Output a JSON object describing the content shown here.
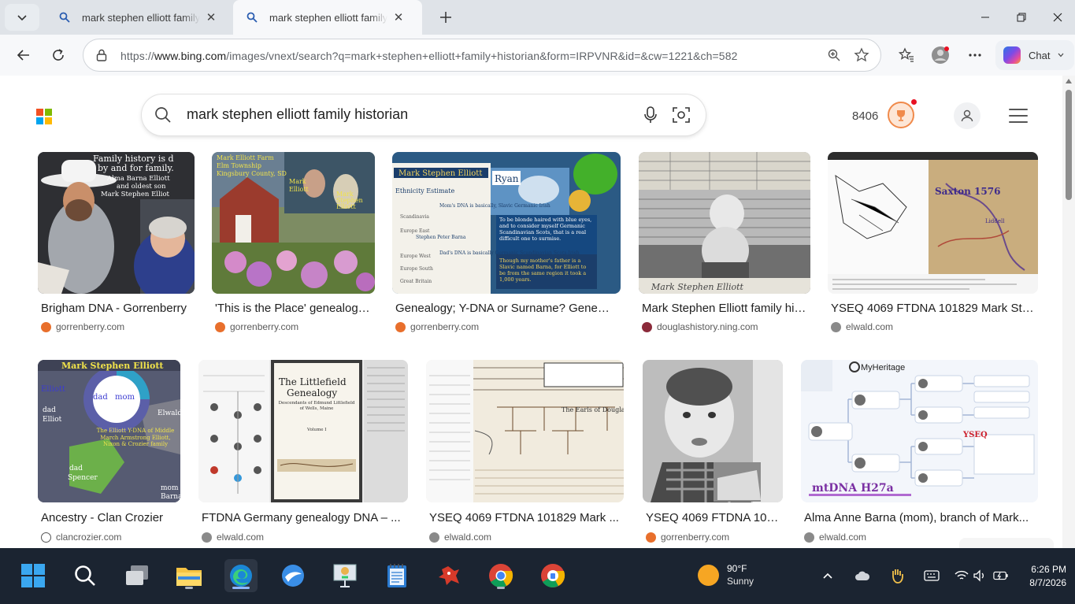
{
  "browser": {
    "tabs": [
      {
        "title": "mark stephen elliott family historian",
        "active": false
      },
      {
        "title": "mark stephen elliott family historian",
        "active": true
      }
    ],
    "url_prefix": "https://",
    "url_domain": "www.bing.com",
    "url_path": "/images/vnext/search?q=mark+stephen+elliott+family+historian&form=IRPVNR&id=&cw=1221&ch=582",
    "copilot_label": "Chat"
  },
  "bing": {
    "query": "mark stephen elliott family historian",
    "rewards_points": "8406",
    "results": [
      {
        "title": "Brigham DNA - Gorrenberry",
        "source": "gorrenberry.com",
        "thumb_text": [
          "Family history is d",
          "by and for family.",
          "Alma Barna Elliott",
          "and oldest son",
          "Mark Stephen Elliot"
        ]
      },
      {
        "title": "'This is the Place' genealogy a...",
        "source": "gorrenberry.com",
        "thumb_text": [
          "Mark Elliott Farm",
          "Elm Township",
          "Kingsbury County, SD",
          "Mark",
          "Elliott",
          "Mark",
          "Stephen",
          "Elliott"
        ]
      },
      {
        "title": "Genealogy; Y-DNA or Surname? Genealogy...",
        "source": "gorrenberry.com",
        "thumb_text": [
          "Mark Stephen Elliott",
          "Ryan",
          "Ethnicity Estimate",
          "Mom's DNA is basically, Slavic Germanic Irish",
          "To be blonde haired with blue eyes, and to consider myself Germanic Scandinavian Scots, that is a real difficult one to surmise.",
          "Stephen Peter Barna",
          "Dad's DNA is basically Germanic Scandinavian Scots-Irish",
          "Though my mother's father is a Slavic named Barna, for Elliott to be from the same region it took a 1,000 years.",
          "Scandinavia",
          "Europe East",
          "Europe West",
          "Europe South",
          "Great Britain"
        ]
      },
      {
        "title": "Mark Stephen Elliott family historia...",
        "source": "douglashistory.ning.com",
        "thumb_text": [
          "Mark Stephen Elliott"
        ]
      },
      {
        "title": "YSEQ 4069 FTDNA 101829 Mark Steph...",
        "source": "elwald.com",
        "thumb_text": [
          "Saxton 1576",
          "Liddell"
        ]
      },
      {
        "title": "Ancestry - Clan Crozier",
        "source": "clancrozier.com",
        "thumb_text": [
          "Mark Stephen Elliott",
          "Elliott",
          "dad",
          "mom",
          "dad",
          "Elliot",
          "Elwald",
          "The Elliott Y-DNA of Middle March Armstrong Elliott, Nixon & Crozier family",
          "dad",
          "Spencer",
          "mom",
          "Barna"
        ]
      },
      {
        "title": "FTDNA Germany genealogy DNA – ...",
        "source": "elwald.com",
        "thumb_text": [
          "The Littlefield",
          "Genealogy",
          "Descendants of Edmund Littlefield of Wells, Maine",
          "Volume I"
        ]
      },
      {
        "title": "YSEQ 4069 FTDNA 101829 Mark ...",
        "source": "elwald.com",
        "thumb_text": [
          "The Earls of Douglas"
        ]
      },
      {
        "title": "YSEQ 4069 FTDNA 101...",
        "source": "gorrenberry.com",
        "thumb_text": []
      },
      {
        "title": "Alma Anne Barna (mom), branch of Mark...",
        "source": "elwald.com",
        "thumb_text": [
          "MyHeritage",
          "mtDNA H27a",
          "YSEQ"
        ]
      }
    ]
  },
  "taskbar": {
    "weather_temp": "90°F",
    "weather_condition": "Sunny",
    "time": "6:26 PM",
    "date": "8/7/2026"
  }
}
